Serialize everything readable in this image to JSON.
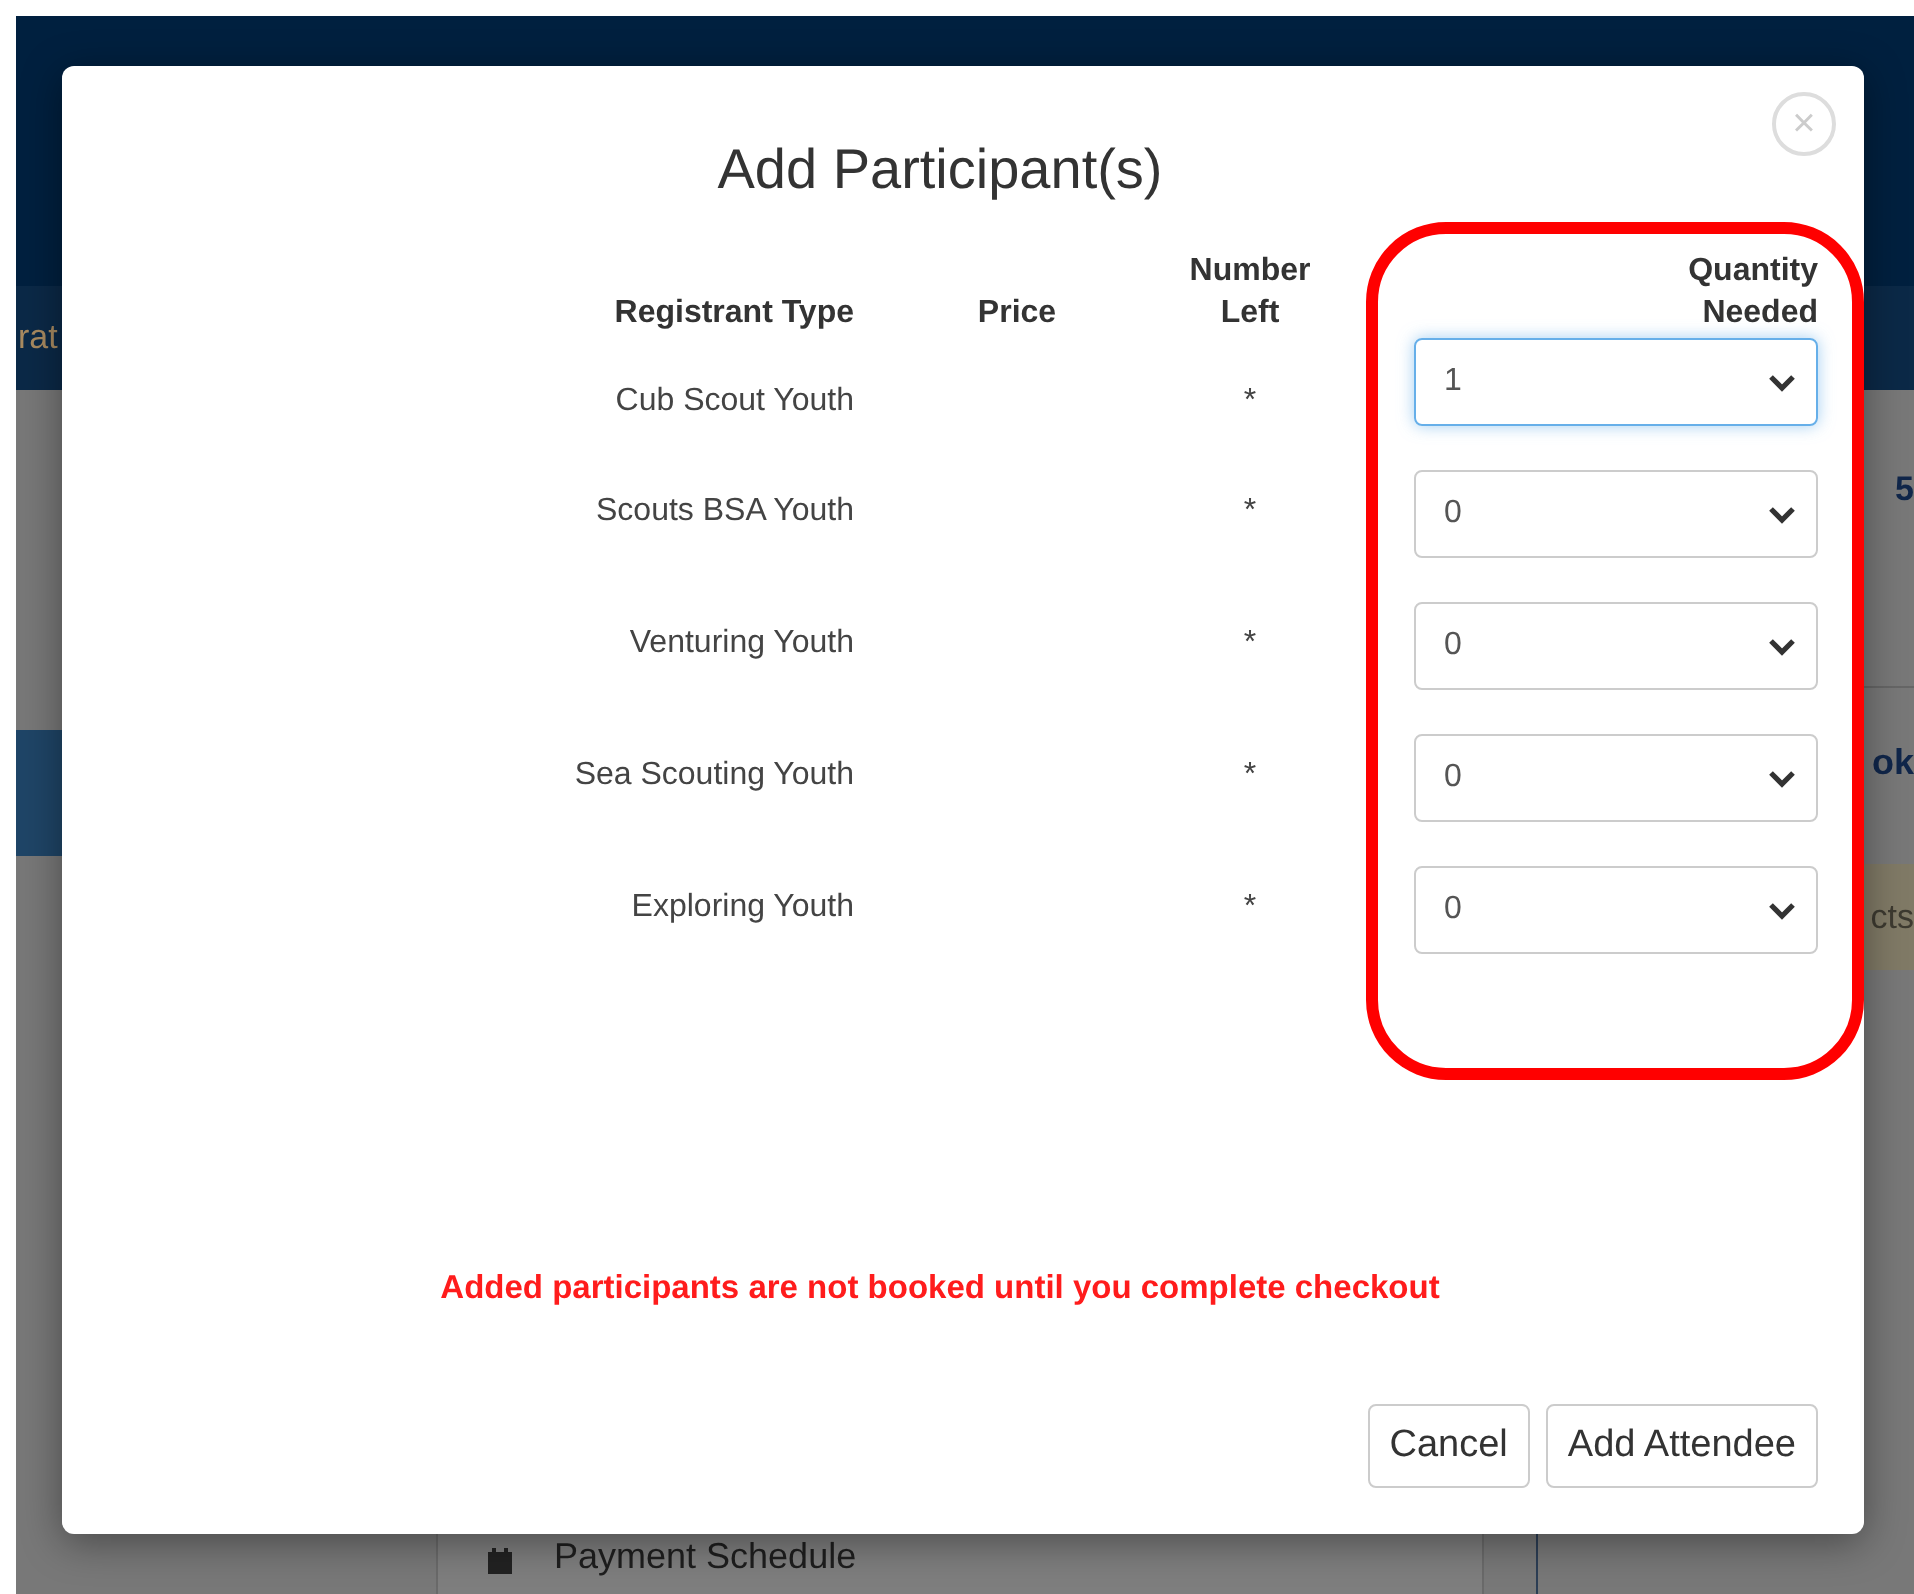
{
  "background": {
    "nav_fragment": "rat",
    "right_fragments": [
      "5",
      "ok",
      "cts"
    ],
    "menu_item": "Payment Schedule"
  },
  "modal": {
    "title": "Add Participant(s)",
    "close": "×",
    "columns": [
      "Registrant Type",
      "Price",
      "Number\nLeft",
      "Quantity\nNeeded"
    ],
    "rows": [
      {
        "type": "Cub Scout Youth",
        "number_left": "*",
        "quantity": "1",
        "focused": true
      },
      {
        "type": "Scouts BSA Youth",
        "number_left": "*",
        "quantity": "0",
        "focused": false
      },
      {
        "type": "Venturing Youth",
        "number_left": "*",
        "quantity": "0",
        "focused": false
      },
      {
        "type": "Sea Scouting Youth",
        "number_left": "*",
        "quantity": "0",
        "focused": false
      },
      {
        "type": "Exploring Youth",
        "number_left": "*",
        "quantity": "0",
        "focused": false
      }
    ],
    "notice": "Added participants are not booked until you complete checkout",
    "buttons": [
      "Cancel",
      "Add Attendee"
    ],
    "highlight": true
  }
}
